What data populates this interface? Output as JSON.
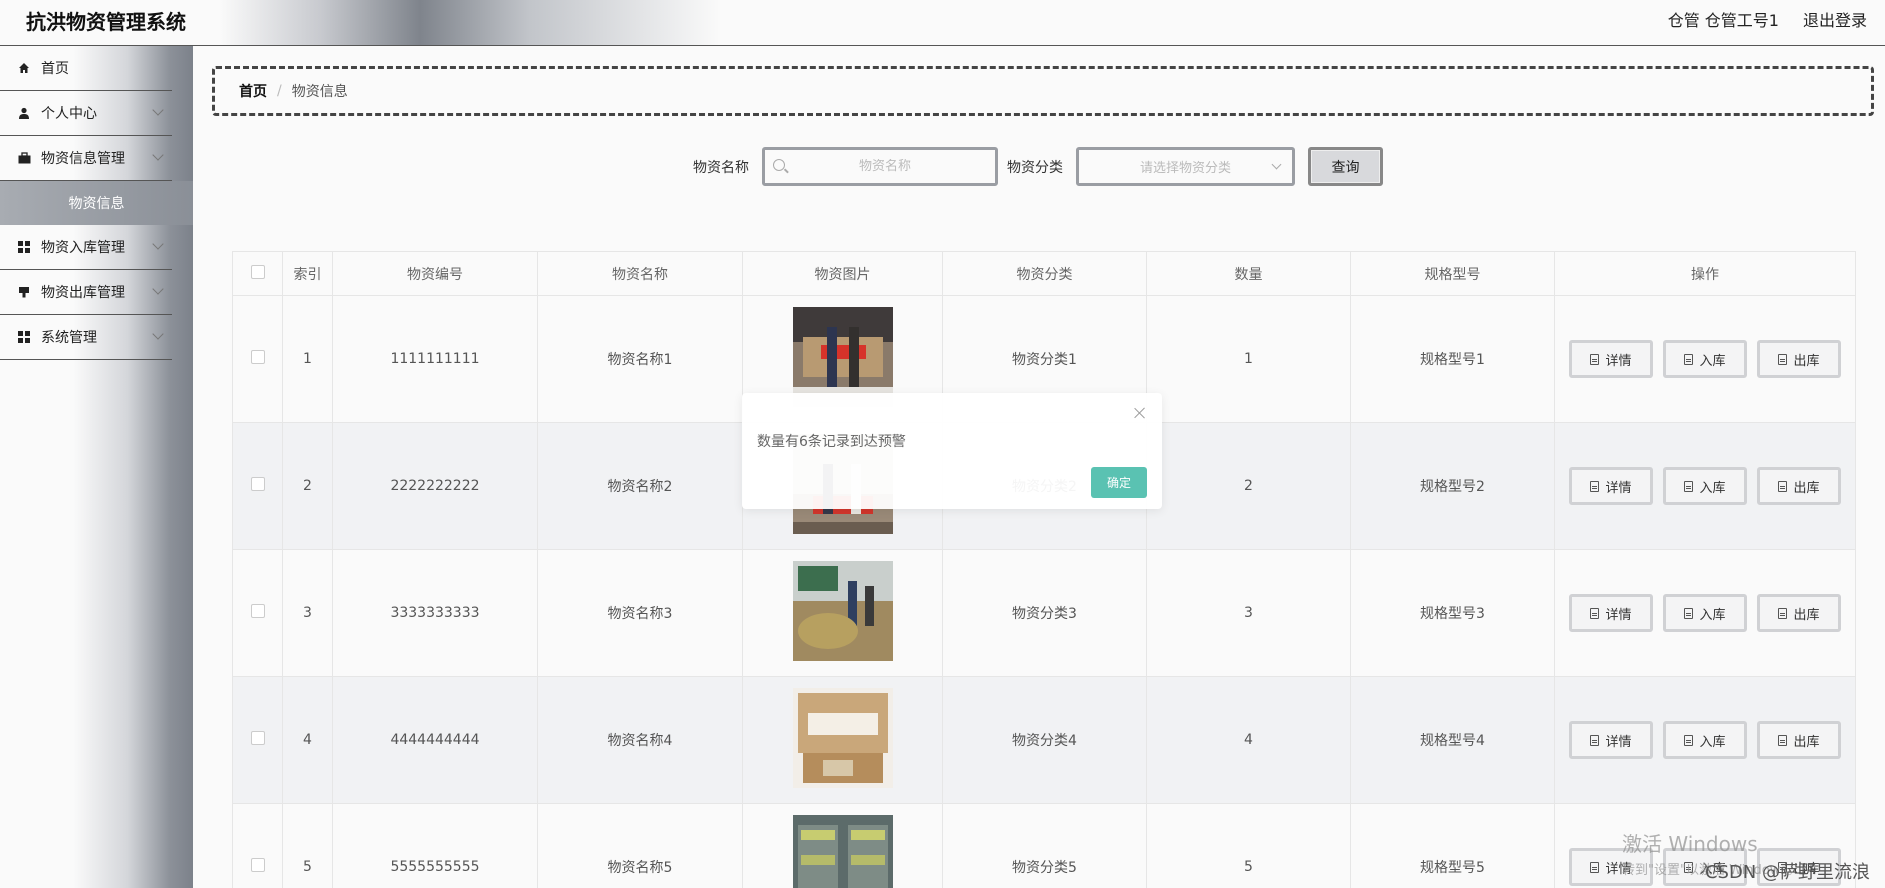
{
  "app": {
    "title": "抗洪物资管理系统",
    "user": "仓管 仓管工号1",
    "logout": "退出登录"
  },
  "sidebar": {
    "items": [
      {
        "label": "首页",
        "icon": "home-icon"
      },
      {
        "label": "个人中心",
        "icon": "user-icon"
      },
      {
        "label": "物资信息管理",
        "icon": "briefcase-icon"
      },
      {
        "label": "物资入库管理",
        "icon": "grid-icon"
      },
      {
        "label": "物资出库管理",
        "icon": "stamp-icon"
      },
      {
        "label": "系统管理",
        "icon": "grid-icon"
      }
    ],
    "submenu_active": "物资信息"
  },
  "breadcrumb": {
    "home": "首页",
    "separator": "/",
    "current": "物资信息"
  },
  "search": {
    "name_label": "物资名称",
    "name_placeholder": "物资名称",
    "category_label": "物资分类",
    "category_placeholder": "请选择物资分类",
    "query_button": "查询"
  },
  "table": {
    "headers": [
      "索引",
      "物资编号",
      "物资名称",
      "物资图片",
      "物资分类",
      "数量",
      "规格型号",
      "操作"
    ],
    "rows": [
      {
        "index": "1",
        "code": "1111111111",
        "name": "物资名称1",
        "category": "物资分类1",
        "quantity": "1",
        "spec": "规格型号1"
      },
      {
        "index": "2",
        "code": "2222222222",
        "name": "物资名称2",
        "category": "物资分类2",
        "quantity": "2",
        "spec": "规格型号2"
      },
      {
        "index": "3",
        "code": "3333333333",
        "name": "物资名称3",
        "category": "物资分类3",
        "quantity": "3",
        "spec": "规格型号3"
      },
      {
        "index": "4",
        "code": "4444444444",
        "name": "物资名称4",
        "category": "物资分类4",
        "quantity": "4",
        "spec": "规格型号4"
      },
      {
        "index": "5",
        "code": "5555555555",
        "name": "物资名称5",
        "category": "物资分类5",
        "quantity": "5",
        "spec": "规格型号5"
      }
    ],
    "actions": {
      "detail": "详情",
      "stock_in": "入库",
      "stock_out": "出库"
    }
  },
  "dialog": {
    "message": "数量有6条记录到达预警",
    "confirm": "确定"
  },
  "watermark": {
    "line1": "激活 Windows",
    "line2": "转到\"设置\"以激活 Windows。"
  },
  "credit": "CSDN @萨野里流浪",
  "colors": {
    "accent": "#5ac2b2",
    "sidebar_dark": "#7c818a"
  }
}
